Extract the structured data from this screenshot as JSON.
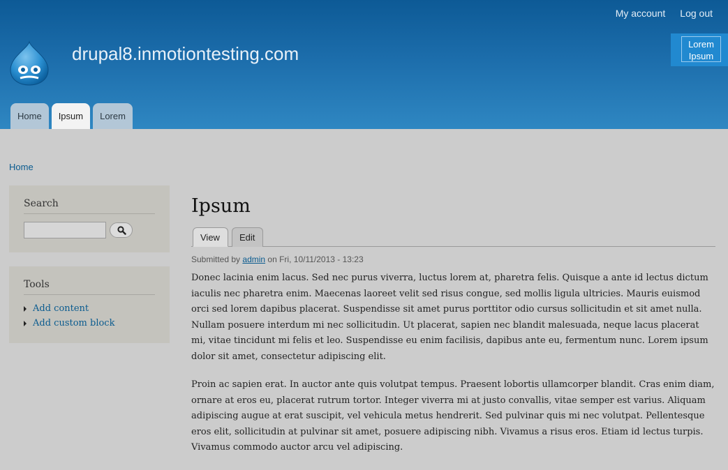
{
  "header": {
    "site_name": "drupal8.inmotiontesting.com",
    "secondary_menu": [
      "My account",
      "Log out"
    ],
    "block_text_line1": "Lorem",
    "block_text_line2": "Ipsum",
    "logo_icon": "drupal-drop-logo"
  },
  "main_menu": {
    "tabs": [
      {
        "label": "Home",
        "active": false
      },
      {
        "label": "Ipsum",
        "active": true
      },
      {
        "label": "Lorem",
        "active": false
      }
    ]
  },
  "breadcrumb": {
    "home": "Home"
  },
  "sidebar": {
    "search": {
      "title": "Search",
      "placeholder": "",
      "button_icon": "search-icon"
    },
    "tools": {
      "title": "Tools",
      "items": [
        "Add content",
        "Add custom block"
      ]
    }
  },
  "content": {
    "title": "Ipsum",
    "local_tabs": [
      "View",
      "Edit"
    ],
    "submitted_prefix": "Submitted by",
    "author": "admin",
    "submitted_suffix": "on Fri, 10/11/2013 - 13:23",
    "paragraphs": [
      "Donec lacinia enim lacus. Sed nec purus viverra, luctus lorem at, pharetra felis. Quisque a ante id lectus dictum iaculis nec pharetra enim. Maecenas laoreet velit sed risus congue, sed mollis ligula ultricies. Mauris euismod orci sed lorem dapibus placerat. Suspendisse sit amet purus porttitor odio cursus sollicitudin et sit amet nulla. Nullam posuere interdum mi nec sollicitudin. Ut placerat, sapien nec blandit malesuada, neque lacus placerat mi, vitae tincidunt mi felis et leo. Suspendisse eu enim facilisis, dapibus ante eu, fermentum nunc. Lorem ipsum dolor sit amet, consectetur adipiscing elit.",
      "Proin ac sapien erat. In auctor ante quis volutpat tempus. Praesent lobortis ullamcorper blandit. Cras enim diam, ornare at eros eu, placerat rutrum tortor. Integer viverra mi at justo convallis, vitae semper est varius. Aliquam adipiscing augue at erat suscipit, vel vehicula metus hendrerit. Sed pulvinar quis mi nec volutpat. Pellentesque eros elit, sollicitudin at pulvinar sit amet, posuere adipiscing nibh. Vivamus a risus eros. Etiam id lectus turpis. Vivamus commodo auctor arcu vel adipiscing."
    ]
  },
  "colors": {
    "header_top": "#0d5a96",
    "header_bottom": "#2f87c2",
    "page_bg": "#cccccc",
    "link": "#0a5b8f",
    "sidebar_block_bg": "#c4c3bd"
  }
}
